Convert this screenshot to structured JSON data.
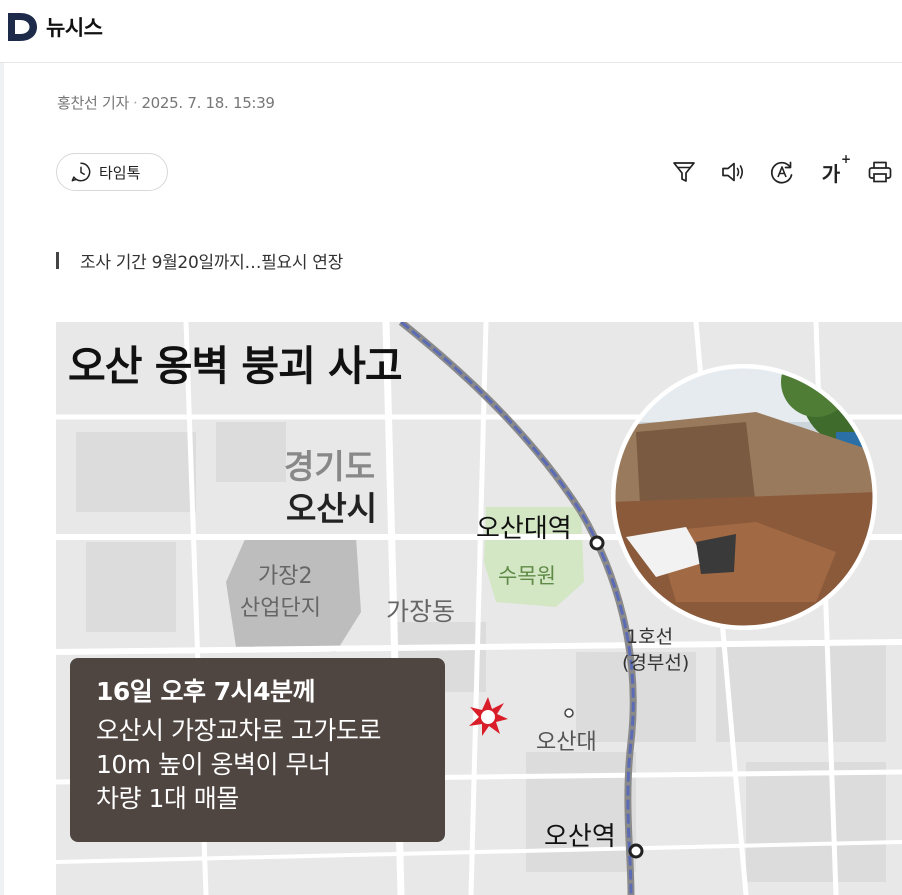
{
  "header": {
    "site_name": "뉴시스",
    "logo_icon": "newsis-logo-icon"
  },
  "article": {
    "reporter": "홍찬선 기자",
    "separator": "·",
    "datetime": "2025. 7. 18. 15:39",
    "subtitle": "조사 기간 9월20일까지…필요시 연장"
  },
  "toolbar": {
    "timetalk_label": "타임톡",
    "font_label": "가",
    "font_plus": "+",
    "icons": [
      "filter-icon",
      "speaker-icon",
      "translate-icon",
      "font-size-icon",
      "print-icon"
    ]
  },
  "figure": {
    "title": "오산 옹벽 붕괴 사고",
    "labels": {
      "province": "경기도",
      "city": "오산시",
      "industrial_1": "가장2",
      "industrial_2": "산업단지",
      "district": "가장동",
      "station1": "오산대역",
      "park": "수목원",
      "line_1": "1호선",
      "line_2": "(경부선)",
      "university": "오산대",
      "station2": "오산역"
    },
    "info": {
      "headline": "16일 오후 7시4분께",
      "line1": "오산시 가장교차로 고가도로",
      "line2": "10m 높이  옹벽이 무너",
      "line3": "차량 1대 매몰"
    },
    "colors": {
      "infobox": "#4f4541",
      "rail": "#5b6bb5",
      "marker": "#d91e2a"
    }
  }
}
